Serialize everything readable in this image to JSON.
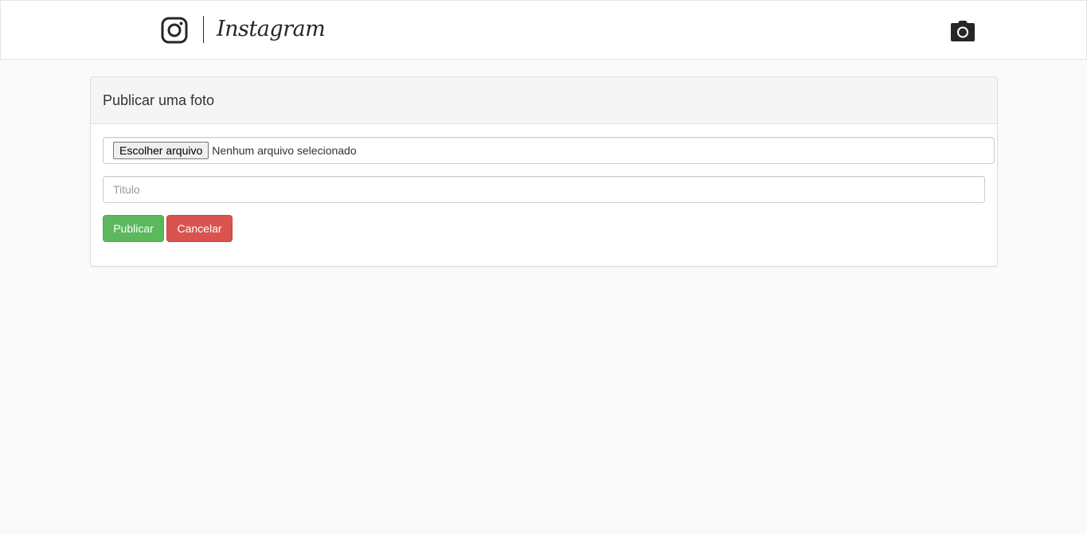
{
  "header": {
    "brand_name": "Instagram",
    "logo_icon": "instagram-glyph-icon",
    "camera_icon": "camera-icon"
  },
  "panel": {
    "title": "Publicar uma foto",
    "file_input": {
      "button_label": "Escolher arquivo",
      "status_text": "Nenhum arquivo selecionado"
    },
    "title_input": {
      "value": "",
      "placeholder": "Titulo"
    },
    "publish_label": "Publicar",
    "cancel_label": "Cancelar"
  },
  "colors": {
    "page_background": "#fafafa",
    "publish_button": "#5cb85c",
    "cancel_button": "#d9534f",
    "panel_heading": "#f5f5f5"
  }
}
